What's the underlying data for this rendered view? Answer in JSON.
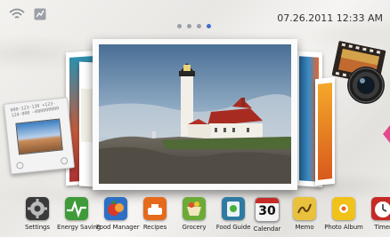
{
  "status_bar": {
    "wifi_icon": "wifi-icon",
    "signal_icon": "signal-icon",
    "datetime": "07.26.2011 12:33 AM"
  },
  "pager": {
    "pages": 4,
    "active_index": 3
  },
  "gallery": {
    "main_photo": "lighthouse-photo",
    "slide_text": "000-123-130 +123-124-000 ~000000000"
  },
  "dock": [
    {
      "label": "Settings",
      "icon": "settings-icon",
      "color": "#3a3a3a"
    },
    {
      "label": "Energy Saving",
      "icon": "energy-saving-icon",
      "color": "#3f9a3a"
    },
    {
      "label": "Food Manager",
      "icon": "food-manager-icon",
      "color": "#2d6fc4"
    },
    {
      "label": "Recipes",
      "icon": "recipes-icon",
      "color": "#e56a1c"
    },
    {
      "label": "Grocery",
      "icon": "grocery-icon",
      "color": "#6cab36"
    },
    {
      "label": "Food Guide",
      "icon": "food-guide-icon",
      "color": "#2f7aa0"
    },
    {
      "label": "Calendar",
      "icon": "calendar-icon",
      "color": "#f4f4f4",
      "calendar_day": "30"
    },
    {
      "label": "Memo",
      "icon": "memo-icon",
      "color": "#e9c13c"
    },
    {
      "label": "Photo Album",
      "icon": "photo-album-icon",
      "color": "#f0c21a"
    },
    {
      "label": "Timer",
      "icon": "timer-icon",
      "color": "#c62a26"
    }
  ]
}
